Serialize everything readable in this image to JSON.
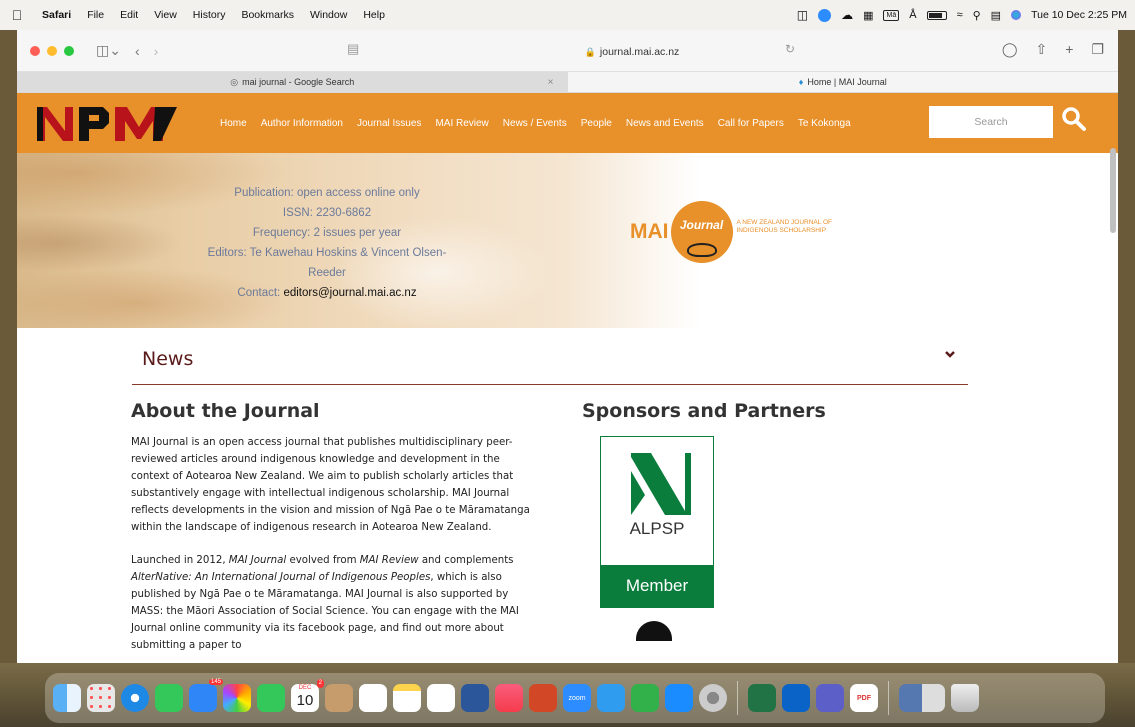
{
  "menubar": {
    "app": "Safari",
    "items": [
      "File",
      "Edit",
      "View",
      "History",
      "Bookmarks",
      "Window",
      "Help"
    ],
    "clock": "Tue 10 Dec  2:25 PM"
  },
  "browser": {
    "address": "journal.mai.ac.nz",
    "tabs": [
      {
        "label": "mai journal - Google Search"
      },
      {
        "label": "Home | MAI Journal"
      }
    ]
  },
  "site": {
    "nav": [
      "Home",
      "Author Information",
      "Journal Issues",
      "MAI Review",
      "News / Events",
      "People",
      "News and Events",
      "Call for Papers",
      "Te Kokonga"
    ],
    "search_placeholder": "Search",
    "hero": {
      "publication": "Publication: open access online only",
      "issn": "ISSN: 2230-6862",
      "frequency": "Frequency: 2 issues per year",
      "editors": "Editors: Te Kawehau Hoskins & Vincent Olsen-Reeder",
      "contact_label": "Contact:",
      "contact_email": "editors@journal.mai.ac.nz"
    },
    "logo_brand": "MAI",
    "logo_journal": "Journal",
    "logo_tagline": "A NEW ZEALAND JOURNAL OF INDIGENOUS SCHOLARSHIP",
    "news_title": "News",
    "about": {
      "heading": "About the Journal",
      "p1": "MAI Journal is an open access journal that publishes multidisciplinary peer-reviewed articles around indigenous knowledge and development in the context of Aotearoa New Zealand. We aim to publish scholarly articles that substantively engage with intellectual indigenous scholarship. MAI Journal reflects developments in the vision and mission of Ngā Pae o te Māramatanga within the landscape of indigenous research in Aotearoa New Zealand.",
      "p2_a": "Launched in 2012, ",
      "p2_b": "MAI Journal",
      "p2_c": " evolved from ",
      "p2_d": "MAI Review",
      "p2_e": " and complements ",
      "p2_f": "AlterNative: An International Journal of Indigenous Peoples",
      "p2_g": ", which is also published by Ngā Pae o te Māramatanga. MAI Journal is also supported by MASS: the Māori Association of Social Science. You can engage with the MAI Journal online community via its facebook page, and find out more about submitting a paper to"
    },
    "sponsors": {
      "heading": "Sponsors and Partners",
      "alpsp_name": "ALPSP",
      "alpsp_status": "Member"
    }
  },
  "colors": {
    "header_orange": "#e8902a",
    "alpsp_green": "#0a7d3c",
    "news_maroon": "#5a1a1a"
  },
  "dock": {
    "icons": [
      "finder-icon",
      "launchpad-icon",
      "safari-icon",
      "messages-icon",
      "mail-icon",
      "photos-icon",
      "facetime-icon",
      "calendar-icon",
      "contacts-icon",
      "reminders-icon",
      "notes-icon",
      "freeform-icon",
      "word-icon",
      "music-icon",
      "powerpoint-icon",
      "zoom-icon",
      "keynote-icon",
      "numbers-icon",
      "app-store-icon",
      "system-settings-icon",
      "excel-icon",
      "outlook-icon",
      "teams-icon",
      "acrobat-icon",
      "preview-icon",
      "trash-icon"
    ],
    "calendar_month": "DEC",
    "calendar_day": "10",
    "mail_badge": "145",
    "calendar_badge": "2",
    "zoom_label": "zoom",
    "pdf_label": "PDF"
  }
}
